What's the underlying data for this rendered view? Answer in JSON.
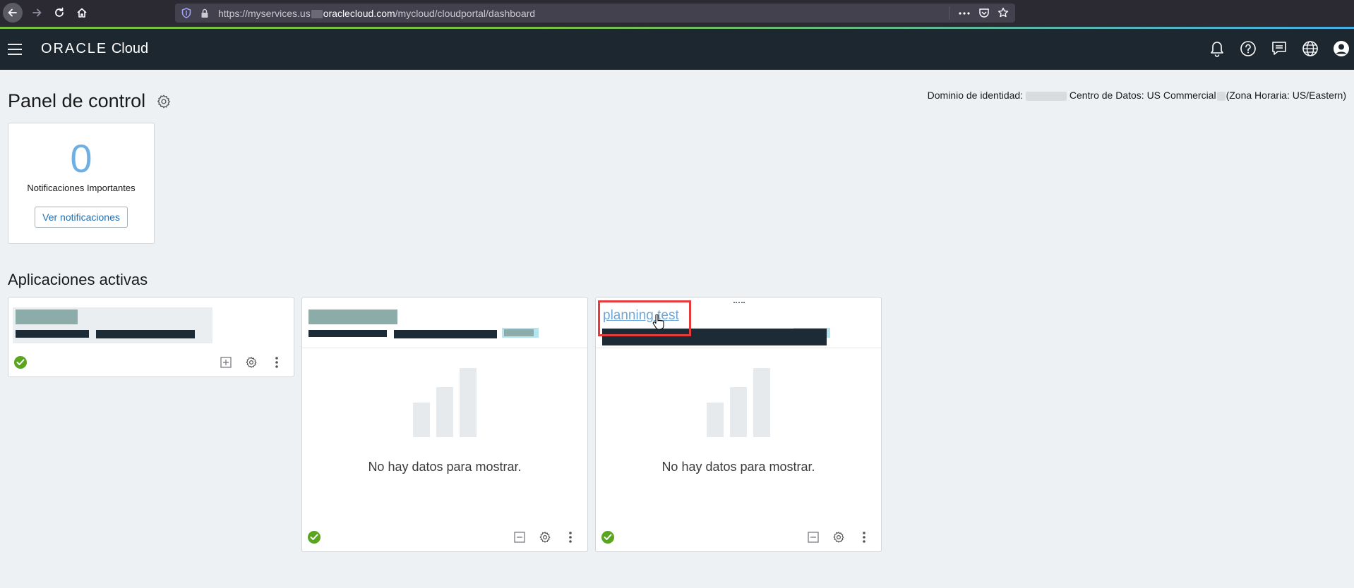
{
  "browser": {
    "url_prefix": "https://myservices.us",
    "url_domain": "oraclecloud.com",
    "url_path": "/mycloud/cloudportal/dashboard"
  },
  "header": {
    "brand_oracle": "ORACLE",
    "brand_cloud": "Cloud",
    "icons": [
      "notifications-bell-icon",
      "help-icon",
      "chat-icon",
      "globe-icon",
      "user-avatar-icon"
    ]
  },
  "page": {
    "title": "Panel de control",
    "identity_label": "Dominio de identidad:",
    "datacenter_label": "Centro de Datos: US Commercial",
    "timezone_label": "(Zona Horaria: US/Eastern)"
  },
  "notifications": {
    "count": "0",
    "label": "Notificaciones Importantes",
    "button": "Ver notificaciones"
  },
  "apps": {
    "section_title": "Aplicaciones activas",
    "cards": [
      {
        "name": "",
        "status": "ok"
      },
      {
        "name": "",
        "status": "ok",
        "empty_text": "No hay datos para mostrar."
      },
      {
        "name": "planning test",
        "status": "ok",
        "empty_text": "No hay datos para mostrar."
      }
    ]
  },
  "colors": {
    "header_bg": "#1c2730",
    "page_bg": "#eef1f4",
    "status_green": "#5aa51e",
    "link_blue": "#6fa7d8",
    "highlight_red": "#e53b3b"
  }
}
